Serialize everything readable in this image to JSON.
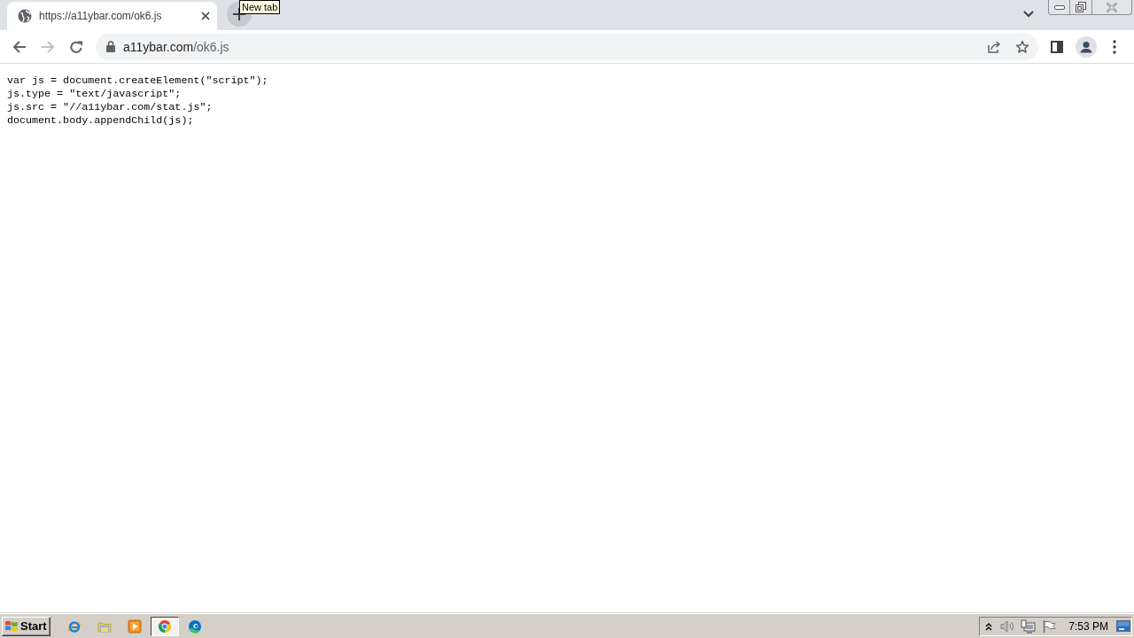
{
  "window": {
    "tabs": [
      {
        "title": "https://a11ybar.com/ok6.js",
        "selected": true
      }
    ],
    "new_tab_button": {
      "hovered": true,
      "tooltip": "New tab"
    }
  },
  "toolbar": {
    "back_disabled": false,
    "forward_disabled": true,
    "address": {
      "host": "a11ybar.com",
      "path": "/ok6.js"
    }
  },
  "document": {
    "lines": [
      "var js = document.createElement(\"script\");",
      "js.type = \"text/javascript\";",
      "js.src = \"//a11ybar.com/stat.js\";",
      "document.body.appendChild(js);"
    ]
  },
  "taskbar": {
    "start_label": "Start",
    "apps": [
      {
        "kind": "ie",
        "selected": false
      },
      {
        "kind": "folder",
        "selected": false
      },
      {
        "kind": "media",
        "selected": false
      },
      {
        "kind": "chrome",
        "selected": true
      },
      {
        "kind": "edge",
        "selected": false
      }
    ],
    "clock": "7:53 PM"
  }
}
